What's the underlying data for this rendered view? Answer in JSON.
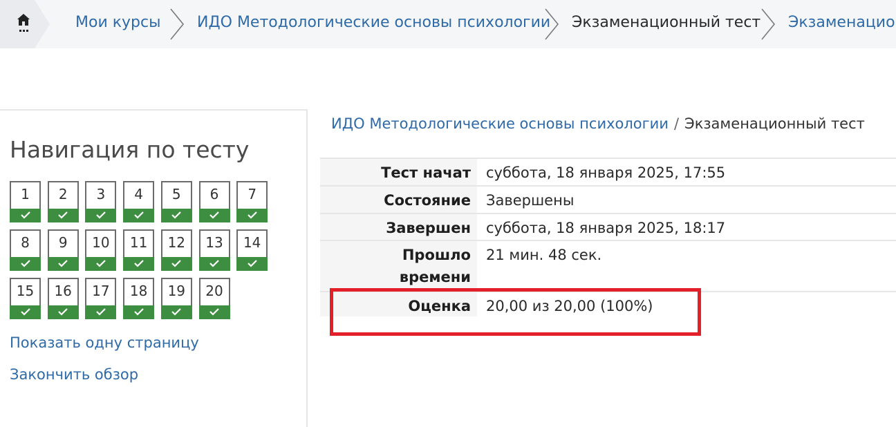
{
  "breadcrumb": {
    "items": [
      {
        "label": "Мои курсы",
        "link": true
      },
      {
        "label": "ИДО Методологические основы психологии",
        "link": true
      },
      {
        "label": "Экзаменационный тест",
        "link": false
      },
      {
        "label": "Экзаменацион",
        "link": true
      }
    ]
  },
  "navigation": {
    "title": "Навигация по тесту",
    "questions": [
      "1",
      "2",
      "3",
      "4",
      "5",
      "6",
      "7",
      "8",
      "9",
      "10",
      "11",
      "12",
      "13",
      "14",
      "15",
      "16",
      "17",
      "18",
      "19",
      "20"
    ],
    "state_icon": "check-icon",
    "state_color": "#3e8e41",
    "show_one_page_label": "Показать одну страницу",
    "finish_review_label": "Закончить обзор"
  },
  "content_breadcrumb": {
    "course": "ИДО Методологические основы психологии",
    "separator": "/",
    "quiz": "Экзаменационный тест"
  },
  "summary": {
    "rows": [
      {
        "label": "Тест начат",
        "value": "суббота, 18 января 2025, 17:55"
      },
      {
        "label": "Состояние",
        "value": "Завершены"
      },
      {
        "label": "Завершен",
        "value": "суббота, 18 января 2025, 18:17"
      },
      {
        "label": "Прошло времени",
        "value": "21 мин. 48 сек."
      },
      {
        "label": "Оценка",
        "value": "20,00 из 20,00 (100%)"
      }
    ]
  },
  "colors": {
    "link": "#2f6aa8",
    "highlight": "#e3202a",
    "check_background": "#3e8e41"
  }
}
